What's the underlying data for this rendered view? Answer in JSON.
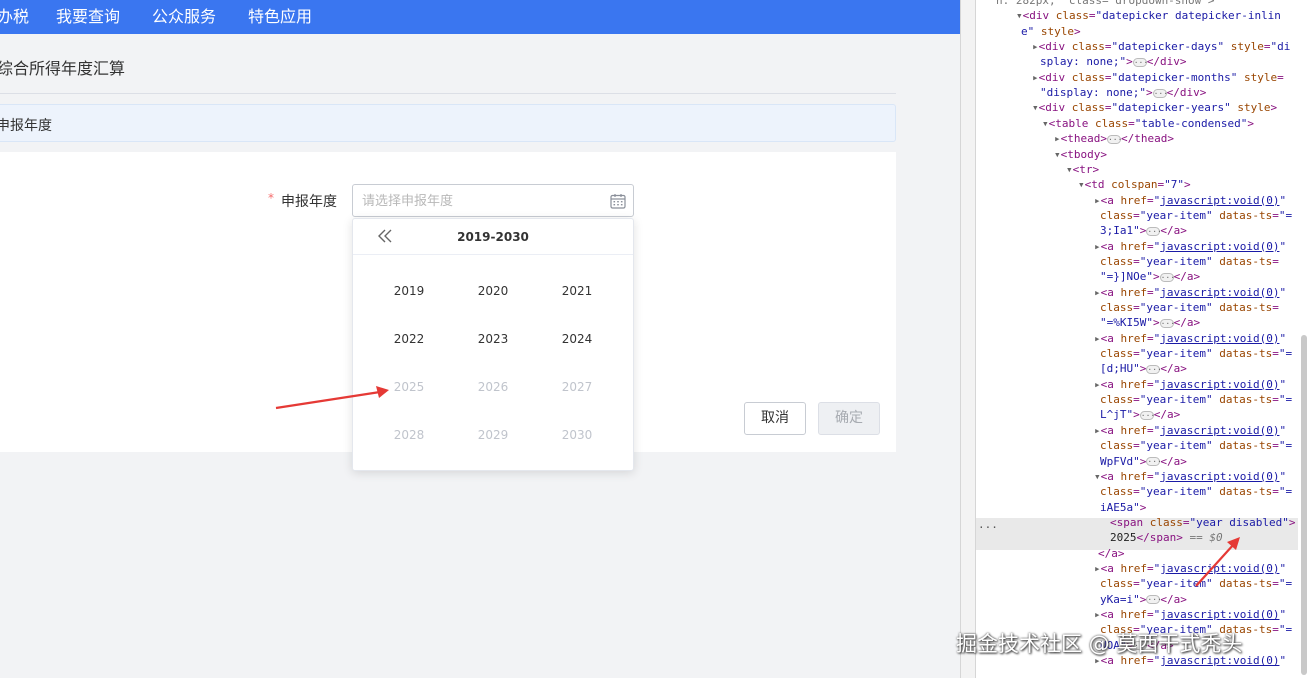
{
  "nav": {
    "items": [
      "办税",
      "我要查询",
      "公众服务",
      "特色应用"
    ]
  },
  "page": {
    "title": "综合所得年度汇算",
    "section_title": "申报年度"
  },
  "form": {
    "required_mark": "*",
    "year_label": "申报年度",
    "year_placeholder": "请选择申报年度",
    "year_value": ""
  },
  "datepicker": {
    "range": "2019-2030",
    "years": [
      {
        "label": "2019",
        "disabled": false
      },
      {
        "label": "2020",
        "disabled": false
      },
      {
        "label": "2021",
        "disabled": false
      },
      {
        "label": "2022",
        "disabled": false
      },
      {
        "label": "2023",
        "disabled": false
      },
      {
        "label": "2024",
        "disabled": false
      },
      {
        "label": "2025",
        "disabled": true
      },
      {
        "label": "2026",
        "disabled": true
      },
      {
        "label": "2027",
        "disabled": true
      },
      {
        "label": "2028",
        "disabled": true
      },
      {
        "label": "2029",
        "disabled": true
      },
      {
        "label": "2030",
        "disabled": true
      }
    ]
  },
  "buttons": {
    "cancel": "取消",
    "confirm": "确定"
  },
  "devtools": {
    "lines": [
      {
        "html": "<span class=\"dim\">n: 282px;  class= dropdown-show ></span>"
      },
      {
        "html": "<span class=\"tri\">▾</span><span class=\"tag\">&lt;div </span><span class=\"attr\">class</span>=<span class=\"val\">\"datepicker datepicker-inlin</span>"
      },
      {
        "html": "<span class=\"val\">e\"</span> <span class=\"attr\">style</span><span class=\"tag\">&gt;</span>"
      },
      {
        "html": "<span class=\"tri\">▸</span><span class=\"tag\">&lt;div </span><span class=\"attr\">class</span>=<span class=\"val\">\"datepicker-days\"</span> <span class=\"attr\">style</span>=<span class=\"val\">\"di</span>"
      },
      {
        "html": "<span class=\"val\">splay: none;\"</span><span class=\"tag\">&gt;</span><span class=\"ell\">···</span><span class=\"tag\">&lt;/div&gt;</span>"
      },
      {
        "html": "<span class=\"tri\">▸</span><span class=\"tag\">&lt;div </span><span class=\"attr\">class</span>=<span class=\"val\">\"datepicker-months\"</span> <span class=\"attr\">style</span>="
      },
      {
        "html": "<span class=\"val\">\"display: none;\"</span><span class=\"tag\">&gt;</span><span class=\"ell\">···</span><span class=\"tag\">&lt;/div&gt;</span>"
      },
      {
        "html": "<span class=\"tri\">▾</span><span class=\"tag\">&lt;div </span><span class=\"attr\">class</span>=<span class=\"val\">\"datepicker-years\"</span> <span class=\"attr\">style</span><span class=\"tag\">&gt;</span>"
      },
      {
        "html": "<span class=\"tri\">▾</span><span class=\"tag\">&lt;table </span><span class=\"attr\">class</span>=<span class=\"val\">\"table-condensed\"</span><span class=\"tag\">&gt;</span>"
      },
      {
        "html": "<span class=\"tri\">▸</span><span class=\"tag\">&lt;thead&gt;</span><span class=\"ell\">···</span><span class=\"tag\">&lt;/thead&gt;</span>"
      },
      {
        "html": "<span class=\"tri\">▾</span><span class=\"tag\">&lt;tbody&gt;</span>"
      },
      {
        "html": "<span class=\"tri\">▾</span><span class=\"tag\">&lt;tr&gt;</span>"
      },
      {
        "html": "<span class=\"tri\">▾</span><span class=\"tag\">&lt;td </span><span class=\"attr\">colspan</span>=<span class=\"val\">\"7\"</span><span class=\"tag\">&gt;</span>"
      },
      {
        "html": "<span class=\"tri\">▸</span><span class=\"tag\">&lt;a </span><span class=\"attr\">href</span>=<span class=\"val\">\"</span><span class=\"link\">javascript:void(0)</span><span class=\"val\">\"</span>"
      },
      {
        "html": "<span class=\"attr\">class</span>=<span class=\"val\">\"year-item\"</span> <span class=\"attr\">datas-ts</span>=<span class=\"val\">\"=</span>"
      },
      {
        "html": "<span class=\"val\">3;Ia1\"</span><span class=\"tag\">&gt;</span><span class=\"ell\">···</span><span class=\"tag\">&lt;/a&gt;</span>"
      },
      {
        "html": "<span class=\"tri\">▸</span><span class=\"tag\">&lt;a </span><span class=\"attr\">href</span>=<span class=\"val\">\"</span><span class=\"link\">javascript:void(0)</span><span class=\"val\">\"</span>"
      },
      {
        "html": "<span class=\"attr\">class</span>=<span class=\"val\">\"year-item\"</span> <span class=\"attr\">datas-ts</span>="
      },
      {
        "html": "<span class=\"val\">\"=}]NOe\"</span><span class=\"tag\">&gt;</span><span class=\"ell\">···</span><span class=\"tag\">&lt;/a&gt;</span>"
      },
      {
        "html": "<span class=\"tri\">▸</span><span class=\"tag\">&lt;a </span><span class=\"attr\">href</span>=<span class=\"val\">\"</span><span class=\"link\">javascript:void(0)</span><span class=\"val\">\"</span>"
      },
      {
        "html": "<span class=\"attr\">class</span>=<span class=\"val\">\"year-item\"</span> <span class=\"attr\">datas-ts</span>="
      },
      {
        "html": "<span class=\"val\">\"=%KI5W\"</span><span class=\"tag\">&gt;</span><span class=\"ell\">···</span><span class=\"tag\">&lt;/a&gt;</span>"
      },
      {
        "html": "<span class=\"tri\">▸</span><span class=\"tag\">&lt;a </span><span class=\"attr\">href</span>=<span class=\"val\">\"</span><span class=\"link\">javascript:void(0)</span><span class=\"val\">\"</span>"
      },
      {
        "html": "<span class=\"attr\">class</span>=<span class=\"val\">\"year-item\"</span> <span class=\"attr\">datas-ts</span>=<span class=\"val\">\"=</span>"
      },
      {
        "html": "<span class=\"val\">[d;HU\"</span><span class=\"tag\">&gt;</span><span class=\"ell\">···</span><span class=\"tag\">&lt;/a&gt;</span>"
      },
      {
        "html": "<span class=\"tri\">▸</span><span class=\"tag\">&lt;a </span><span class=\"attr\">href</span>=<span class=\"val\">\"</span><span class=\"link\">javascript:void(0)</span><span class=\"val\">\"</span>"
      },
      {
        "html": "<span class=\"attr\">class</span>=<span class=\"val\">\"year-item\"</span> <span class=\"attr\">datas-ts</span>=<span class=\"val\">\"=</span>"
      },
      {
        "html": "<span class=\"val\">L^jT\"</span><span class=\"tag\">&gt;</span><span class=\"ell\">···</span><span class=\"tag\">&lt;/a&gt;</span>"
      },
      {
        "html": "<span class=\"tri\">▸</span><span class=\"tag\">&lt;a </span><span class=\"attr\">href</span>=<span class=\"val\">\"</span><span class=\"link\">javascript:void(0)</span><span class=\"val\">\"</span>"
      },
      {
        "html": "<span class=\"attr\">class</span>=<span class=\"val\">\"year-item\"</span> <span class=\"attr\">datas-ts</span>=<span class=\"val\">\"=</span>"
      },
      {
        "html": "<span class=\"val\">WpFVd\"</span><span class=\"tag\">&gt;</span><span class=\"ell\">···</span><span class=\"tag\">&lt;/a&gt;</span>"
      },
      {
        "html": "<span class=\"tri\">▾</span><span class=\"tag\">&lt;a </span><span class=\"attr\">href</span>=<span class=\"val\">\"</span><span class=\"link\">javascript:void(0)</span><span class=\"val\">\"</span>"
      },
      {
        "html": "<span class=\"attr\">class</span>=<span class=\"val\">\"year-item\"</span> <span class=\"attr\">datas-ts</span>=<span class=\"val\">\"=</span>"
      },
      {
        "html": "<span class=\"val\">iAE5a\"</span><span class=\"tag\">&gt;</span>"
      },
      {
        "html": "<span class=\"tag\">&lt;span </span><span class=\"attr\">class</span>=<span class=\"val\">\"year disabled\"</span><span class=\"tag\">&gt;</span>"
      },
      {
        "html": "<span class=\"text\">2025</span><span class=\"tag\">&lt;/span&gt;</span> <span class=\"dim\">== <i>$0</i></span>"
      },
      {
        "html": "<span class=\"tag\">&lt;/a&gt;</span>"
      },
      {
        "html": "<span class=\"tri\">▸</span><span class=\"tag\">&lt;a </span><span class=\"attr\">href</span>=<span class=\"val\">\"</span><span class=\"link\">javascript:void(0)</span><span class=\"val\">\"</span>"
      },
      {
        "html": "<span class=\"attr\">class</span>=<span class=\"val\">\"year-item\"</span> <span class=\"attr\">datas-ts</span>=<span class=\"val\">\"=</span>"
      },
      {
        "html": "<span class=\"val\">yKa=i\"</span><span class=\"tag\">&gt;</span><span class=\"ell\">···</span><span class=\"tag\">&lt;/a&gt;</span>"
      },
      {
        "html": "<span class=\"tri\">▸</span><span class=\"tag\">&lt;a </span><span class=\"attr\">href</span>=<span class=\"val\">\"</span><span class=\"link\">javascript:void(0)</span><span class=\"val\">\"</span>"
      },
      {
        "html": "<span class=\"attr\">class</span>=<span class=\"val\">\"year-item\"</span> <span class=\"attr\">datas-ts</span>=<span class=\"val\">\"=</span>"
      },
      {
        "html": "<span class=\"val\">NOA\"</span><span class=\"tag\">&gt;</span><span class=\"ell\">···</span><span class=\"tag\">&lt;/a&gt;</span>"
      },
      {
        "html": "<span class=\"tri\">▸</span><span class=\"tag\">&lt;a </span><span class=\"attr\">href</span>=<span class=\"val\">\"</span><span class=\"link\">javascript:void(0)</span><span class=\"val\">\"</span>"
      }
    ]
  },
  "watermark": "掘金技术社区 @ 莫西干式秃头",
  "colors": {
    "nav_bg": "#3a76f0",
    "section_bg": "#edf3fc",
    "required": "#f56c6c",
    "disabled_text": "#c0c4cc",
    "arrow": "#e53935"
  }
}
